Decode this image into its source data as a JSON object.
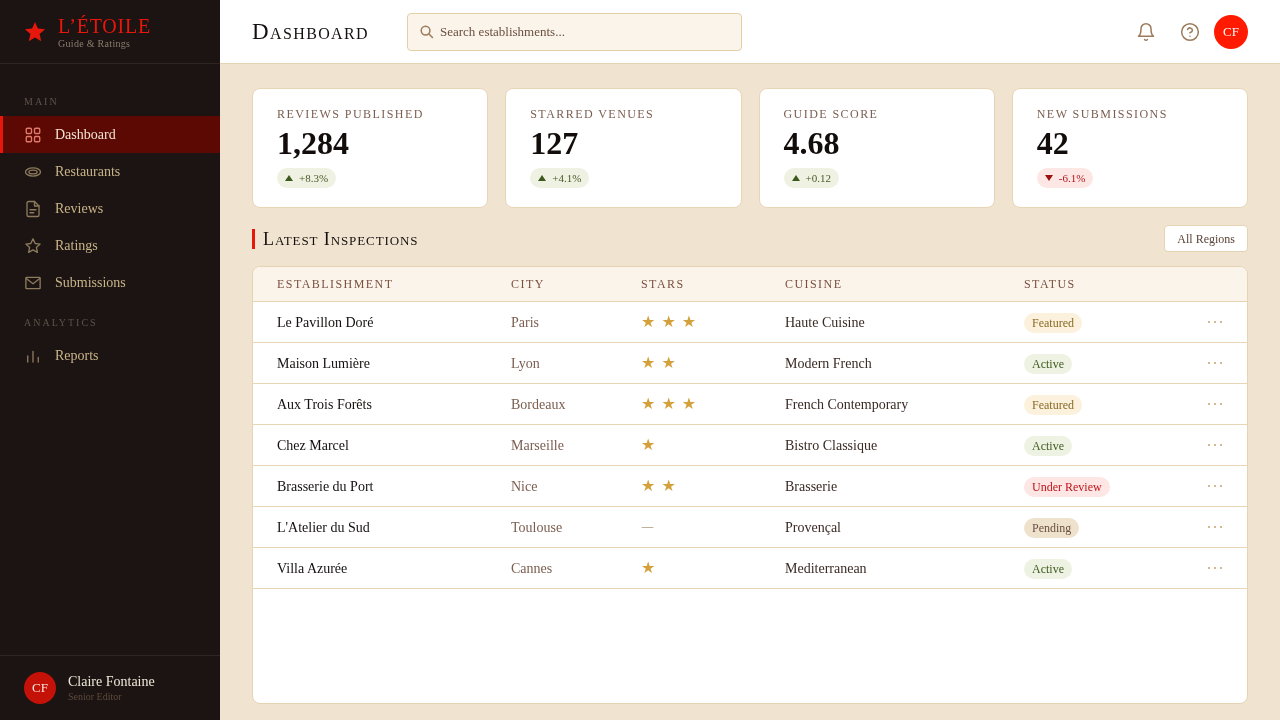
{
  "brand": {
    "name": "L’ÉTOILE",
    "tagline": "Guide & Ratings"
  },
  "sidebar": {
    "sections": [
      {
        "title": "MAIN",
        "items": [
          {
            "label": "Dashboard",
            "selected": true
          },
          {
            "label": "Restaurants",
            "selected": false
          },
          {
            "label": "Reviews",
            "selected": false
          },
          {
            "label": "Ratings",
            "selected": false
          },
          {
            "label": "Submissions",
            "selected": false
          }
        ]
      },
      {
        "title": "ANALYTICS",
        "items": [
          {
            "label": "Reports",
            "selected": false
          }
        ]
      }
    ],
    "user": {
      "initials": "CF",
      "name": "Claire Fontaine",
      "role": "Senior Editor"
    }
  },
  "header": {
    "title": "Dashboard",
    "search": {
      "placeholder": "Search establishments..."
    },
    "avatar": {
      "initials": "CF"
    }
  },
  "stats": [
    {
      "label": "REVIEWS PUBLISHED",
      "value": "1,284",
      "change": "+8.3%",
      "kind": "up"
    },
    {
      "label": "STARRED VENUES",
      "value": "127",
      "change": "+4.1%",
      "kind": "up"
    },
    {
      "label": "GUIDE SCORE",
      "value": "4.68",
      "change": "+0.12",
      "kind": "up"
    },
    {
      "label": "NEW SUBMISSIONS",
      "value": "42",
      "change": "-6.1%",
      "kind": "down"
    }
  ],
  "inspections": {
    "title": "Latest Inspections",
    "filter": "All Regions",
    "table": {
      "columns": [
        "ESTABLISHMENT",
        "CITY",
        "STARS",
        "CUISINE",
        "STATUS"
      ],
      "rows": [
        {
          "name": "Le Pavillon Doré",
          "city": "Paris",
          "rating": "★ ★ ★",
          "rated": true,
          "cuisine": "Haute Cuisine",
          "status": {
            "label": "Featured",
            "kind": "featured"
          }
        },
        {
          "name": "Maison Lumière",
          "city": "Lyon",
          "rating": "★ ★",
          "rated": true,
          "cuisine": "Modern French",
          "status": {
            "label": "Active",
            "kind": "active"
          }
        },
        {
          "name": "Aux Trois Forêts",
          "city": "Bordeaux",
          "rating": "★ ★ ★",
          "rated": true,
          "cuisine": "French Contemporary",
          "status": {
            "label": "Featured",
            "kind": "featured"
          }
        },
        {
          "name": "Chez Marcel",
          "city": "Marseille",
          "rating": "★",
          "rated": true,
          "cuisine": "Bistro Classique",
          "status": {
            "label": "Active",
            "kind": "active"
          }
        },
        {
          "name": "Brasserie du Port",
          "city": "Nice",
          "rating": "★ ★",
          "rated": true,
          "cuisine": "Brasserie",
          "status": {
            "label": "Under Review",
            "kind": "review"
          }
        },
        {
          "name": "L'Atelier du Sud",
          "city": "Toulouse",
          "rating": "—",
          "rated": false,
          "cuisine": "Provençal",
          "status": {
            "label": "Pending",
            "kind": "pending"
          }
        },
        {
          "name": "Villa Azurée",
          "city": "Cannes",
          "rating": "★",
          "rated": true,
          "cuisine": "Mediterranean",
          "status": {
            "label": "Active",
            "kind": "active"
          }
        }
      ]
    }
  }
}
